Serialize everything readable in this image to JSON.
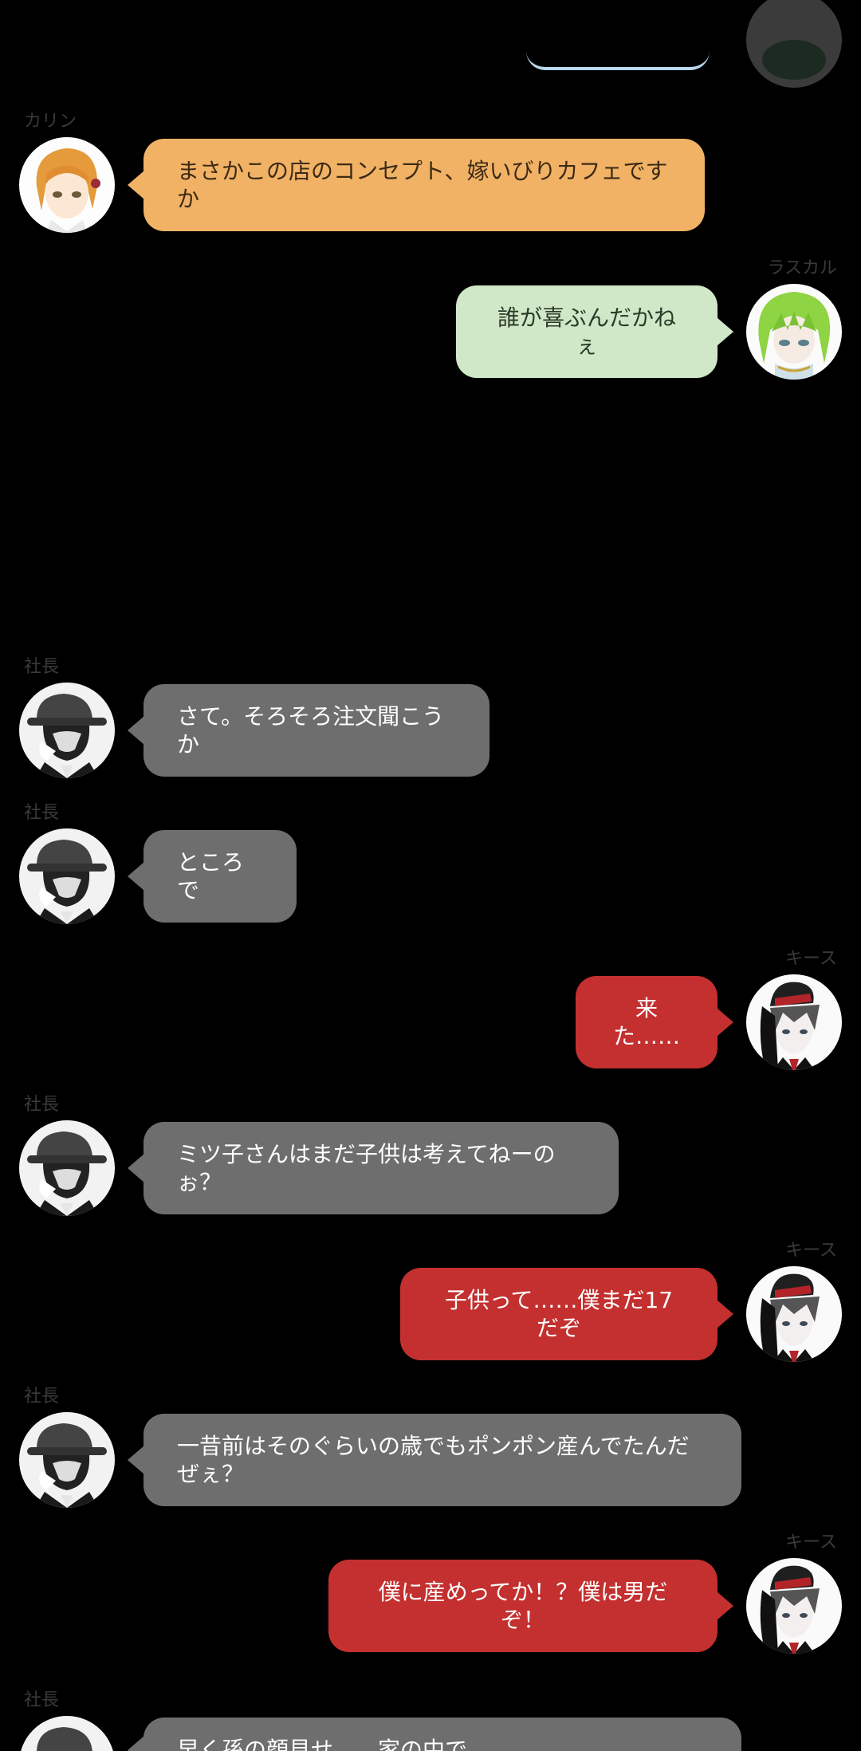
{
  "colors": {
    "background": "#000000",
    "karin_bubble": "#f1b266",
    "rascal_bubble": "#d1e8c8",
    "shachou_bubble": "#6e6e6e",
    "keith_bubble": "#c3302f"
  },
  "messages": [
    {
      "id": "m1",
      "speaker": "カリン",
      "avatar": "karin-avatar",
      "text": "まさかこの店のコンセプト、嫁いびりカフェですか"
    },
    {
      "id": "m2",
      "speaker": "ラスカル",
      "avatar": "rascal-avatar",
      "text": "誰が喜ぶんだかねぇ"
    },
    {
      "id": "m3",
      "speaker": "社長",
      "avatar": "shachou-avatar",
      "text": "さて。そろそろ注文聞こうか"
    },
    {
      "id": "m4",
      "speaker": "社長",
      "avatar": "shachou-avatar",
      "text": "ところで"
    },
    {
      "id": "m5",
      "speaker": "キース",
      "avatar": "keith-avatar",
      "text": "来た……"
    },
    {
      "id": "m6",
      "speaker": "社長",
      "avatar": "shachou-avatar",
      "text": "ミツ子さんはまだ子供は考えてねーのぉ？"
    },
    {
      "id": "m7",
      "speaker": "キース",
      "avatar": "keith-avatar",
      "text": "子供って……僕まだ17だぞ"
    },
    {
      "id": "m8",
      "speaker": "社長",
      "avatar": "shachou-avatar",
      "text_line1": "一昔前はそのぐらいの歳でもポンポン産んでたんだ",
      "text_line2": "ぜぇ？"
    },
    {
      "id": "m9",
      "speaker": "キース",
      "avatar": "keith-avatar",
      "text": "僕に産めってか！？僕は男だぞ！"
    },
    {
      "id": "m10",
      "speaker": "社長",
      "avatar": "shachou-avatar",
      "text": "早く孫の顔見せ……家の中で……"
    }
  ]
}
